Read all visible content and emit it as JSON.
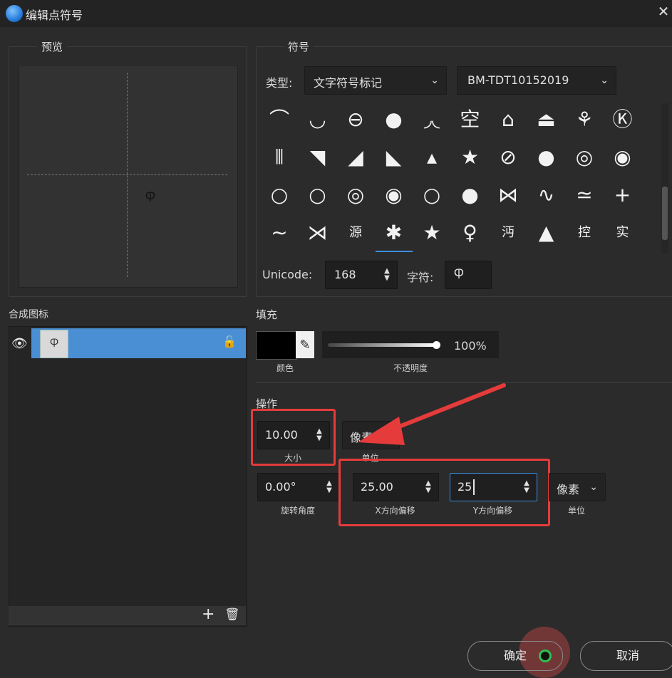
{
  "window": {
    "title": "编辑点符号",
    "close_glyph": "✕"
  },
  "preview": {
    "legend": "预览",
    "glyph": "Ⴔ"
  },
  "symbol": {
    "legend": "符号",
    "type_label": "类型:",
    "type_value": "文字符号标记",
    "font_value": "BM-TDT10152019",
    "grid": [
      [
        "⌒",
        "◡",
        "⊖",
        "●",
        "◞◟",
        "空",
        "⌂",
        "⏏",
        "⚘",
        "Ⓚ"
      ],
      [
        "⫴",
        "◥",
        "◢",
        "◣",
        "▴",
        "★",
        "⊘",
        "●",
        "◎",
        "◉"
      ],
      [
        "○",
        "○",
        "◎",
        "◉",
        "○",
        "●",
        "⋈",
        "∿",
        "≃",
        "+"
      ],
      [
        "∼",
        "⋊",
        "源",
        "✱",
        "★",
        "♀",
        "沔",
        "▲",
        "控",
        "实"
      ]
    ],
    "unicode_label": "Unicode:",
    "unicode_value": "168",
    "char_label": "字符:",
    "char_value": "Ⴔ"
  },
  "composite": {
    "label": "合成图标",
    "layer_glyph": "Ⴔ",
    "eye_icon": "eye-icon",
    "lock_icon": "unlock-icon",
    "add_glyph": "+",
    "delete_glyph": "🗑"
  },
  "fill": {
    "label": "填充",
    "color": "#000000",
    "color_caption": "颜色",
    "opacity_value": "100%",
    "opacity_fraction": 1.0,
    "opacity_caption": "不透明度"
  },
  "operation": {
    "label": "操作",
    "size_value": "10.00",
    "size_caption": "大小",
    "unit1_value": "像素",
    "unit1_caption": "单位",
    "rotation_value": "0.00°",
    "rotation_caption": "旋转角度",
    "xoffset_value": "25.00",
    "xoffset_caption": "X方向偏移",
    "yoffset_value": "25",
    "yoffset_caption": "Y方向偏移",
    "unit2_value": "像素",
    "unit2_caption": "单位"
  },
  "buttons": {
    "ok": "确定",
    "cancel": "取消"
  },
  "colors": {
    "accent": "#4a8fd3",
    "highlight": "#e53b3b",
    "selected_underline": "#3b8fe0"
  }
}
